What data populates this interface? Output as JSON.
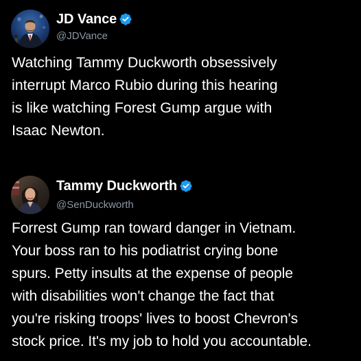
{
  "colors": {
    "background": "#000000",
    "text": "#ffffff",
    "handle": "#8b98a5",
    "verified": "#1d9bf0"
  },
  "tweets": [
    {
      "display_name": "JD Vance",
      "handle": "@JDVance",
      "verified_icon": "verified-badge-icon",
      "text": "Watching Tammy Duckworth obsessively\ninterrupt Marco Rubio during this hearing\nis like watching Forest Gump argue with\nIsaac Newton."
    },
    {
      "display_name": "Tammy Duckworth",
      "handle": "@SenDuckworth",
      "verified_icon": "verified-badge-icon",
      "text": "Forrest Gump ran toward danger in Vietnam.\nYour boss ran to his podiatrist crying bone\nspurs. Petty insults at the expense of people\nwith disabilities won't change the fact that\nyou're risking troops' lives to boost Chevron's\nstock price. It's my job to hold you accountable."
    }
  ]
}
